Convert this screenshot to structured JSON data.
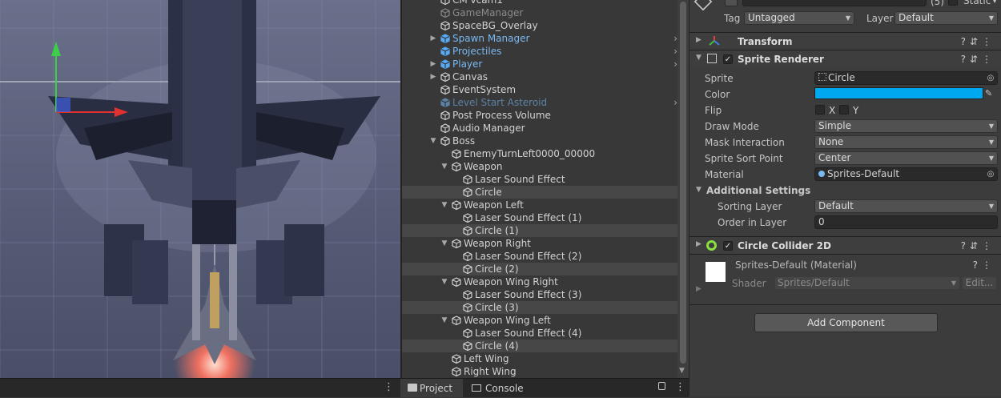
{
  "colors": {
    "accent_blue": "#7ab8f0",
    "sprite_color": "#00a8f0",
    "selection": "#474747"
  },
  "scene_view": {
    "more_menu": "⋮"
  },
  "hierarchy": {
    "items": [
      {
        "label": "CM vcam1",
        "arrow": "",
        "style": ""
      },
      {
        "label": "GameManager",
        "arrow": "",
        "style": "dim"
      },
      {
        "label": "SpaceBG_Overlay",
        "arrow": "",
        "style": ""
      },
      {
        "label": "Spawn Manager",
        "arrow": "▶",
        "style": "blue",
        "chev": "›"
      },
      {
        "label": "Projectiles",
        "arrow": "",
        "style": "blue",
        "chev": "›"
      },
      {
        "label": "Player",
        "arrow": "▶",
        "style": "blue",
        "chev": "›"
      },
      {
        "label": "Canvas",
        "arrow": "▶",
        "style": ""
      },
      {
        "label": "EventSystem",
        "arrow": "",
        "style": ""
      },
      {
        "label": "Level Start Asteroid",
        "arrow": "",
        "style": "dimblue",
        "chev": "›"
      },
      {
        "label": "Post Process Volume",
        "arrow": "",
        "style": ""
      },
      {
        "label": "Audio Manager",
        "arrow": "",
        "style": ""
      },
      {
        "label": "Boss",
        "arrow": "▼",
        "style": ""
      },
      {
        "label": "EnemyTurnLeft0000_00000",
        "arrow": "",
        "style": ""
      },
      {
        "label": "Weapon",
        "arrow": "▼",
        "style": ""
      },
      {
        "label": "Laser Sound Effect",
        "arrow": "",
        "style": ""
      },
      {
        "label": "Circle",
        "arrow": "",
        "style": "",
        "selected": true
      },
      {
        "label": "Weapon Left",
        "arrow": "▼",
        "style": ""
      },
      {
        "label": "Laser Sound Effect (1)",
        "arrow": "",
        "style": ""
      },
      {
        "label": "Circle (1)",
        "arrow": "",
        "style": "",
        "selected": true
      },
      {
        "label": "Weapon Right",
        "arrow": "▼",
        "style": ""
      },
      {
        "label": "Laser Sound Effect (2)",
        "arrow": "",
        "style": ""
      },
      {
        "label": "Circle (2)",
        "arrow": "",
        "style": "",
        "selected": true
      },
      {
        "label": "Weapon Wing Right",
        "arrow": "▼",
        "style": ""
      },
      {
        "label": "Laser Sound Effect (3)",
        "arrow": "",
        "style": ""
      },
      {
        "label": "Circle (3)",
        "arrow": "",
        "style": "",
        "selected": true
      },
      {
        "label": "Weapon Wing Left",
        "arrow": "▼",
        "style": ""
      },
      {
        "label": "Laser Sound Effect (4)",
        "arrow": "",
        "style": ""
      },
      {
        "label": "Circle (4)",
        "arrow": "",
        "style": "",
        "selected": true
      },
      {
        "label": "Left Wing",
        "arrow": "",
        "style": ""
      },
      {
        "label": "Right Wing",
        "arrow": "",
        "style": ""
      }
    ]
  },
  "bottom_tabs": {
    "project": "Project",
    "console": "Console",
    "lock_icon": "🔒",
    "more": "⋮"
  },
  "inspector": {
    "header": {
      "count": "(5)",
      "static_label": "Static",
      "tag_label": "Tag",
      "tag_value": "Untagged",
      "layer_label": "Layer",
      "layer_value": "Default"
    },
    "transform": {
      "title": "Transform"
    },
    "sprite_renderer": {
      "title": "Sprite Renderer",
      "sprite_label": "Sprite",
      "sprite_value": "Circle",
      "color_label": "Color",
      "flip_label": "Flip",
      "flip_x": "X",
      "flip_y": "Y",
      "draw_mode_label": "Draw Mode",
      "draw_mode_value": "Simple",
      "mask_label": "Mask Interaction",
      "mask_value": "None",
      "sort_point_label": "Sprite Sort Point",
      "sort_point_value": "Center",
      "material_label": "Material",
      "material_value": "Sprites-Default",
      "additional_settings": "Additional Settings",
      "sorting_layer_label": "Sorting Layer",
      "sorting_layer_value": "Default",
      "order_label": "Order in Layer",
      "order_value": "0"
    },
    "circle_collider": {
      "title": "Circle Collider 2D"
    },
    "material": {
      "title": "Sprites-Default (Material)",
      "shader_label": "Shader",
      "shader_value": "Sprites/Default",
      "edit_label": "Edit..."
    },
    "add_component": "Add Component"
  }
}
